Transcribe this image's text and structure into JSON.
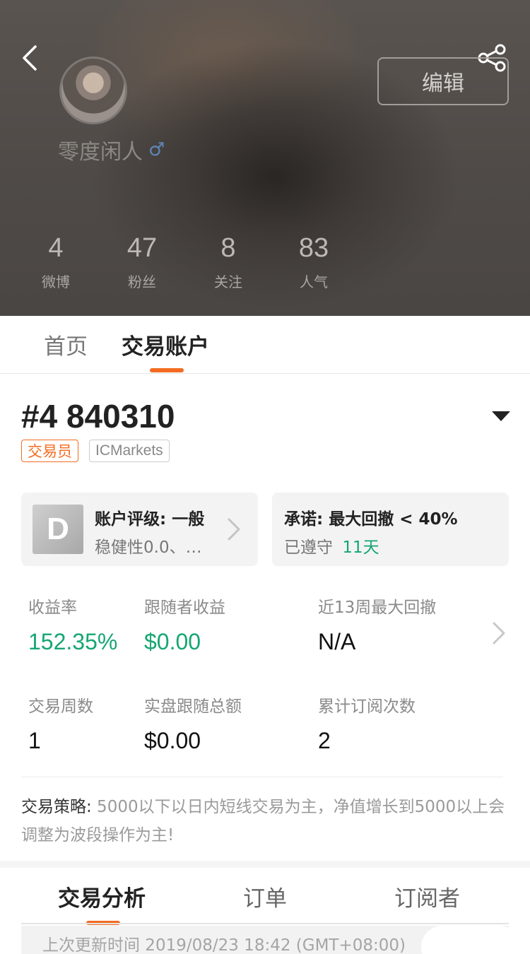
{
  "profile": {
    "username": "零度闲人",
    "gender_symbol": "♂",
    "edit_label": "编辑",
    "stats": [
      {
        "value": "4",
        "label": "微博"
      },
      {
        "value": "47",
        "label": "粉丝"
      },
      {
        "value": "8",
        "label": "关注"
      },
      {
        "value": "83",
        "label": "人气"
      }
    ]
  },
  "tabs": [
    {
      "label": "首页",
      "active": false
    },
    {
      "label": "交易账户",
      "active": true
    }
  ],
  "account": {
    "title": "#4 840310",
    "role_tag": "交易员",
    "broker_tag": "ICMarkets",
    "rating_grade": "D",
    "rating_line1": "账户评级: 一般",
    "rating_line2": "稳健性0.0、…",
    "promise_line1": "承诺: 最大回撤 < 40%",
    "promise_line2_prefix": "已遵守",
    "promise_days": "11天"
  },
  "metrics": {
    "row1": [
      {
        "label": "收益率",
        "value": "152.35%"
      },
      {
        "label": "跟随者收益",
        "value": "$0.00"
      },
      {
        "label": "近13周最大回撤",
        "value": "N/A"
      }
    ],
    "row2": [
      {
        "label": "交易周数",
        "value": "1"
      },
      {
        "label": "实盘跟随总额",
        "value": "$0.00"
      },
      {
        "label": "累计订阅次数",
        "value": "2"
      }
    ]
  },
  "strategy": {
    "label": "交易策略:",
    "text": " 5000以下以日内短线交易为主，净值增长到5000以上会调整为波段操作为主!"
  },
  "bottom_tabs": [
    {
      "label": "交易分析",
      "active": true
    },
    {
      "label": "订单",
      "active": false
    },
    {
      "label": "订阅者",
      "active": false
    }
  ],
  "update_text": "上次更新时间 2019/08/23 18:42 (GMT+08:00)",
  "colors": {
    "accent": "#f36c21",
    "positive": "#16a673",
    "gender": "#5d86b4"
  },
  "icons": {
    "back": "chevron-left-icon",
    "share": "share-icon",
    "dropdown": "caret-down-icon",
    "more": "chevron-right-icon"
  }
}
